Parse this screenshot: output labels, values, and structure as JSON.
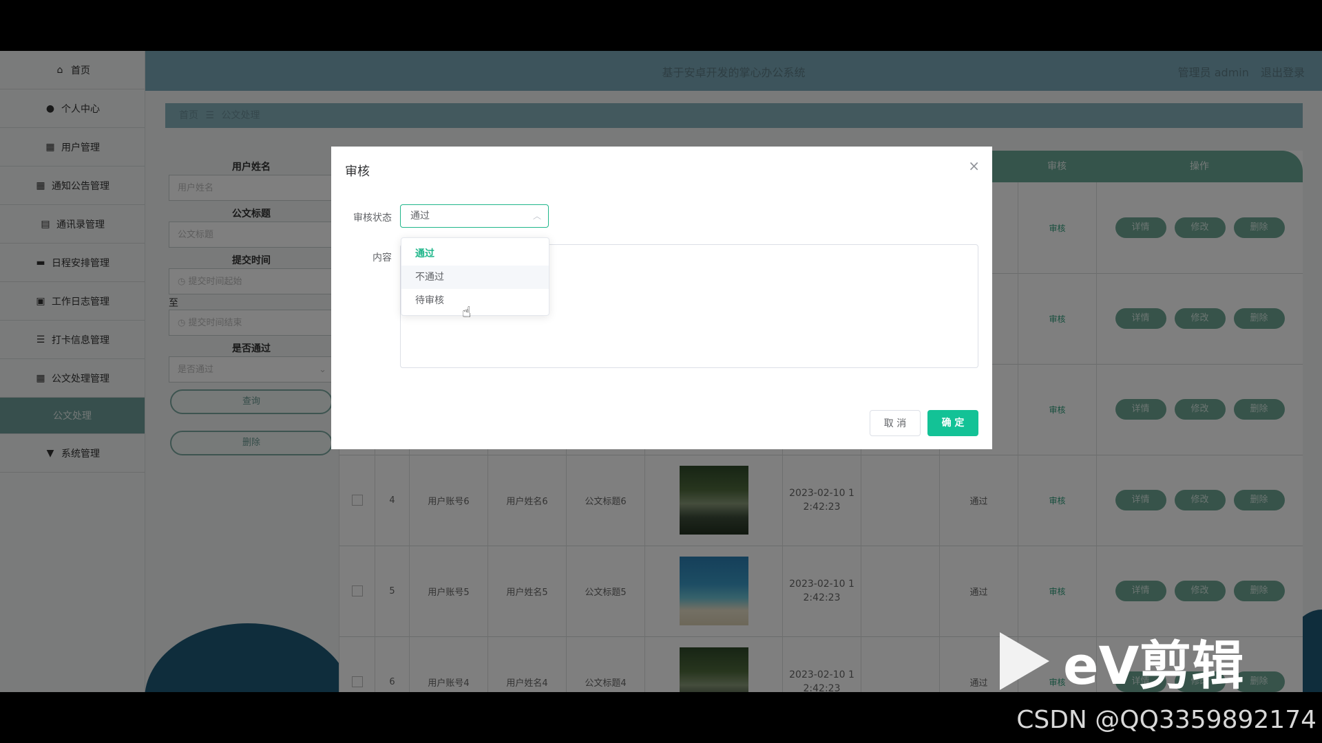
{
  "sidebar": {
    "items": [
      {
        "icon": "home-icon",
        "glyph": "⌂",
        "label": "首页"
      },
      {
        "icon": "user-icon",
        "glyph": "●",
        "label": "个人中心"
      },
      {
        "icon": "grid-icon",
        "glyph": "▦",
        "label": "用户管理"
      },
      {
        "icon": "grid-icon",
        "glyph": "▦",
        "label": "通知公告管理"
      },
      {
        "icon": "contacts-icon",
        "glyph": "▤",
        "label": "通讯录管理"
      },
      {
        "icon": "briefcase-icon",
        "glyph": "▬",
        "label": "日程安排管理"
      },
      {
        "icon": "clipboard-icon",
        "glyph": "▣",
        "label": "工作日志管理"
      },
      {
        "icon": "list-icon",
        "glyph": "☰",
        "label": "打卡信息管理"
      },
      {
        "icon": "grid-icon",
        "glyph": "▦",
        "label": "公文处理管理"
      },
      {
        "label": "公文处理"
      },
      {
        "icon": "settings-icon",
        "glyph": "▼",
        "label": "系统管理"
      }
    ]
  },
  "header": {
    "title": "基于安卓开发的掌心办公系统",
    "user": "管理员 admin",
    "logout": "退出登录"
  },
  "breadcrumb": {
    "home": "首页",
    "sep": "☰",
    "current": "公文处理"
  },
  "search": {
    "name_label": "用户姓名",
    "name_placeholder": "用户姓名",
    "title_label": "公文标题",
    "title_placeholder": "公文标题",
    "time_label": "提交时间",
    "time_start": "提交时间起始",
    "to": "至",
    "time_end": "提交时间结束",
    "pass_label": "是否通过",
    "pass_placeholder": "是否通过",
    "query": "查询",
    "delete": "删除"
  },
  "table": {
    "headers": {
      "audit": "审核",
      "ops": "操作"
    },
    "rows": [
      {
        "idx": "",
        "account": "",
        "name": "",
        "title": "",
        "thumb": "",
        "time": "",
        "status": "",
        "audit": "审核"
      },
      {
        "idx": "",
        "account": "",
        "name": "",
        "title": "",
        "thumb": "",
        "time": "",
        "status": "",
        "audit": "审核"
      },
      {
        "idx": "",
        "account": "",
        "name": "",
        "title": "",
        "thumb": "",
        "time": "",
        "status": "",
        "audit": "审核"
      },
      {
        "idx": "4",
        "account": "用户账号6",
        "name": "用户姓名6",
        "title": "公文标题6",
        "thumb": "forest",
        "time": "2023-02-10 1 2:42:23",
        "status": "通过",
        "audit": "审核"
      },
      {
        "idx": "5",
        "account": "用户账号5",
        "name": "用户姓名5",
        "title": "公文标题5",
        "thumb": "beach",
        "time": "2023-02-10 1 2:42:23",
        "status": "通过",
        "audit": "审核"
      },
      {
        "idx": "6",
        "account": "用户账号4",
        "name": "用户姓名4",
        "title": "公文标题4",
        "thumb": "forest",
        "time": "2023-02-10 1 2:42:23",
        "status": "通过",
        "audit": "审核"
      }
    ],
    "op_labels": {
      "detail": "详情",
      "edit": "修改",
      "delete": "删除"
    }
  },
  "dialog": {
    "title": "审核",
    "close": "×",
    "status_label": "审核状态",
    "status_value": "通过",
    "content_label": "内容",
    "options": [
      "通过",
      "不通过",
      "待审核"
    ],
    "cancel": "取 消",
    "confirm": "确 定"
  },
  "watermark": {
    "text": "eV剪辑",
    "csdn": "CSDN @QQ3359892174"
  }
}
